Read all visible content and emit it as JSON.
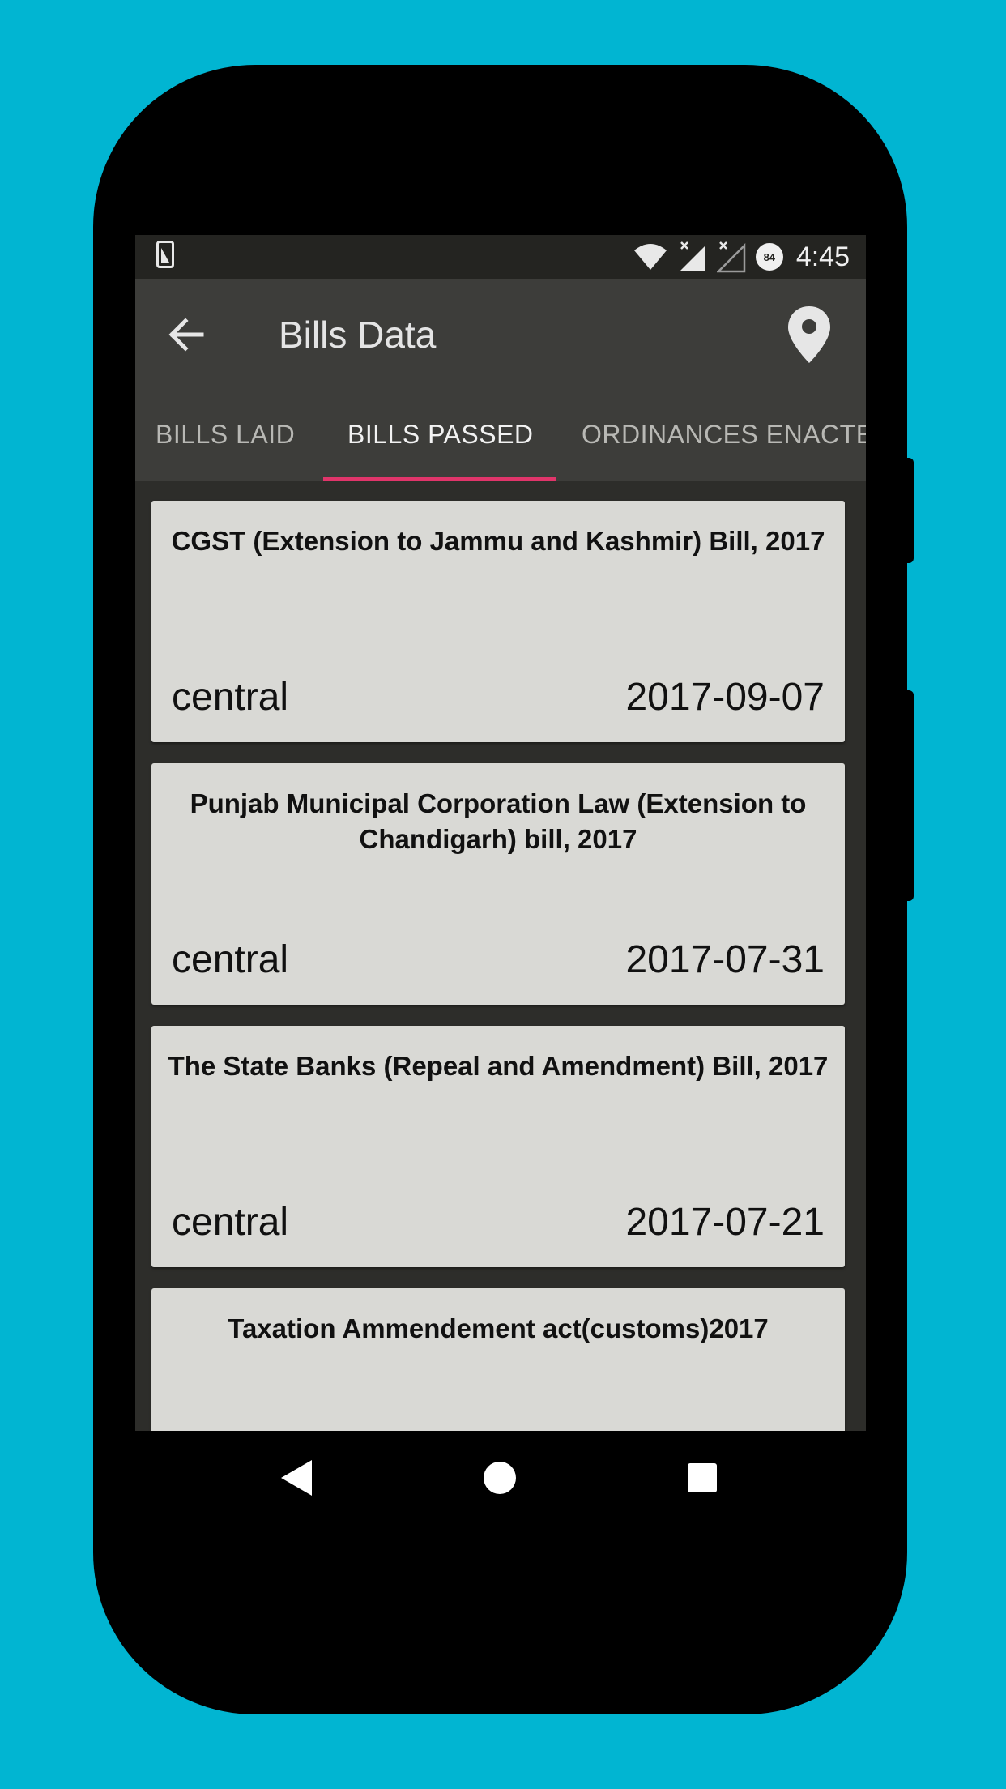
{
  "status_bar": {
    "time": "4:45",
    "battery_level": "84",
    "icons": [
      "screenshot-icon",
      "wifi-icon",
      "signal-icon",
      "signal-icon",
      "battery-icon"
    ]
  },
  "app_bar": {
    "title": "Bills Data",
    "back_icon": "arrow-back-icon",
    "location_icon": "map-pin-icon"
  },
  "tabs": [
    {
      "label": "BILLS LAID",
      "active": false
    },
    {
      "label": "BILLS PASSED",
      "active": true
    },
    {
      "label": "ORDINANCES ENACTED",
      "active": false
    }
  ],
  "bills": [
    {
      "title": "CGST (Extension to Jammu and Kashmir) Bill, 2017",
      "type": "central",
      "date": "2017-09-07"
    },
    {
      "title": "Punjab Municipal Corporation Law (Extension to Chandigarh) bill, 2017",
      "type": "central",
      "date": "2017-07-31"
    },
    {
      "title": "The State Banks (Repeal and Amendment) Bill, 2017",
      "type": "central",
      "date": "2017-07-21"
    },
    {
      "title": "Taxation Ammendement act(customs)2017",
      "type": "",
      "date": ""
    }
  ],
  "nav_bar": {
    "icons": [
      "nav-back-icon",
      "nav-home-icon",
      "nav-recents-icon"
    ]
  },
  "colors": {
    "background": "#01b5d2",
    "app_bar": "#3d3d3a",
    "tab_indicator": "#e0356a",
    "card": "#d9d9d5"
  }
}
